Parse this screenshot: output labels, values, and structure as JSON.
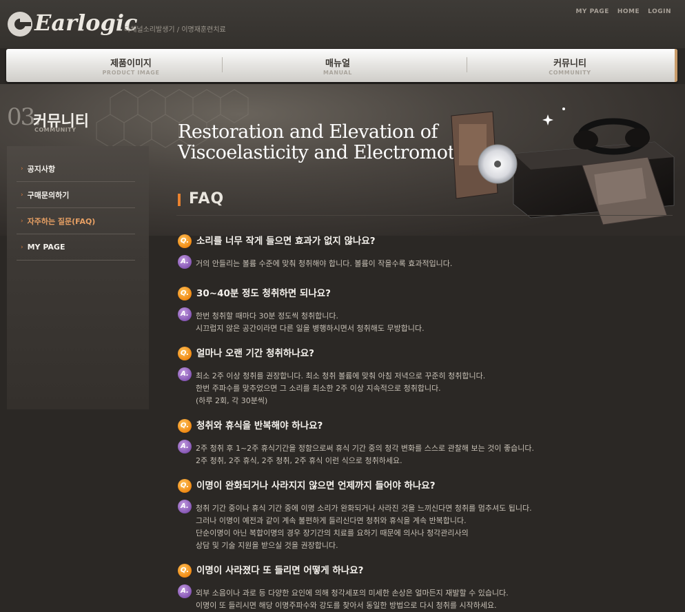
{
  "header": {
    "logo_text": "Earlogic",
    "tagline": "다채널소리발생기 / 이명재훈련치료",
    "links": [
      "MY PAGE",
      "HOME",
      "LOGIN"
    ]
  },
  "nav": [
    {
      "ko": "제품이미지",
      "en": "PRODUCT IMAGE"
    },
    {
      "ko": "매뉴얼",
      "en": "MANUAL"
    },
    {
      "ko": "커뮤니티",
      "en": "COMMUNITY"
    }
  ],
  "hero": {
    "title_line1": "Restoration and Elevation of",
    "title_line2": "Viscoelasticity and Electromotility"
  },
  "sidebar": {
    "number": "03.",
    "title_ko": "커뮤니티",
    "title_en": "COMMUNITY",
    "items": [
      "공지사항",
      "구매문의하기",
      "자주하는 질문(FAQ)",
      "MY PAGE"
    ]
  },
  "page": {
    "title": "FAQ"
  },
  "badges": {
    "q": "Q.",
    "a": "A."
  },
  "faq": [
    {
      "q": "소리를 너무 작게 들으면 효과가 없지 않나요?",
      "a": [
        "거의 안들리는 볼륨 수준에 맞춰 청취해야 합니다. 볼륨이 작을수록 효과적입니다."
      ]
    },
    {
      "q": "30~40분 정도 청취하면 되나요?",
      "a": [
        "한번 청취할 때마다 30분 정도씩 청취합니다.",
        "시끄럽지 않은 공간이라면 다른 일을 병행하시면서 청취해도 무방합니다."
      ]
    },
    {
      "q": "얼마나 오랜 기간 청취하나요?",
      "a": [
        "최소 2주 이상 청취를 권장합니다. 최소 청취 볼륨에 맞춰 아침 저녁으로 꾸준히 청취합니다.",
        "한번 주파수를 맞추었으면 그 소리를 최소한 2주 이상 지속적으로 청취합니다.",
        "(하루 2회, 각 30분씩)"
      ]
    },
    {
      "q": "청취와 휴식을 반복해야 하나요?",
      "a": [
        "2주 청취 후 1~2주 휴식기간을 정함으로써 휴식 기간 중의 청각 변화를 스스로 관찰해 보는 것이 좋습니다.",
        "2주 청취, 2주 휴식, 2주 청취, 2주 휴식 이런 식으로 청취하세요."
      ]
    },
    {
      "q": "이명이 완화되거나 사라지지 않으면 언제까지 들어야 하나요?",
      "a": [
        "청취 기간 중이나 휴식 기간 중에 이명 소리가 완화되거나 사라진 것을 느끼신다면 청취를 멈추셔도 됩니다.",
        "그러나 이명이 예전과 같이 계속 불편하게 들리신다면 청취와 휴식을 계속 반복합니다.",
        "단순이명이 아닌 복합이명의 경우 장기간의 치료를 요하기 때문에 의사나 청각관리사의",
        "상담 및 기술 지원을 받으실 것을 권장합니다."
      ]
    },
    {
      "q": "이명이 사라졌다 또 들리면 어떻게 하나요?",
      "a": [
        "외부 소음이나 과로 등 다양한 요인에 의해 청각세포의 미세한 손상은 얼마든지 재발할 수 있습니다.",
        "이명이 또 들리시면 해당 이명주파수와 강도를 찾아서 동일한 방법으로 다시 청취를 시작하세요."
      ]
    }
  ]
}
